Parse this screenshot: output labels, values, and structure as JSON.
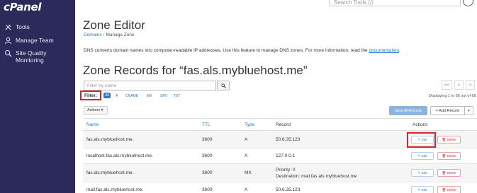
{
  "brand": {
    "logo": "cPanel"
  },
  "sidebar": {
    "items": [
      {
        "label": "Tools",
        "icon": "tools-icon"
      },
      {
        "label": "Manage Team",
        "icon": "team-icon"
      },
      {
        "label": "Site Quality",
        "label2": "Monitoring",
        "icon": "site-quality-icon"
      }
    ]
  },
  "topbar": {
    "search_placeholder": "Search Tools (/)"
  },
  "page": {
    "title": "Zone Editor",
    "breadcrumb": [
      "Domains",
      "Manage Zone"
    ],
    "description": "DNS converts domain names into computer-readable IP addresses. Use this feature to manage DNS zones. For more information, read the ",
    "doc_link": "documentation",
    "description_end": ".",
    "section_title": "Zone Records for “fas.als.mybluehost.me”"
  },
  "toolbar": {
    "filter_placeholder": "Filter by name",
    "filter_label": "Filter:",
    "filter_options": [
      "All",
      "A",
      "CNAME",
      "MX",
      "SRV",
      "TXT"
    ],
    "actions_label": "Actions ▾",
    "save_all_label": "Save All Records",
    "add_record_label": "+ Add Record",
    "add_caret": "▾",
    "pager": [
      "<<",
      "<",
      ">"
    ],
    "display_text": "Displaying 1 to 68 out of 68"
  },
  "table": {
    "headers": {
      "name": "Name",
      "ttl": "TTL",
      "type": "Type",
      "record": "Record",
      "actions": "Actions"
    },
    "edit_label": "Edit",
    "delete_label": "Delete",
    "rows": [
      {
        "name": "fas.als.mybluehost.me.",
        "ttl": "3600",
        "type": "A",
        "record": "50.6.35.123",
        "record2": ""
      },
      {
        "name": "localhost.fas.als.mybluehost.me.",
        "ttl": "3600",
        "type": "A",
        "record": "127.0.0.1",
        "record2": ""
      },
      {
        "name": "fas.als.mybluehost.me.",
        "ttl": "3600",
        "type": "MX",
        "record": "Priority: 0",
        "record2": "Destination: mail.fas.als.mybluehost.me"
      },
      {
        "name": "mail.fas.als.mybluehost.me.",
        "ttl": "3600",
        "type": "A",
        "record": "50.6.35.123",
        "record2": ""
      }
    ]
  }
}
